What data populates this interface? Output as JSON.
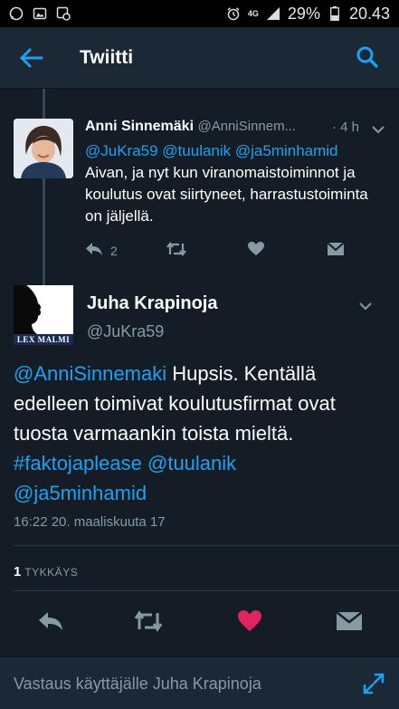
{
  "status_bar": {
    "left_icons": [
      "whatsapp-icon",
      "image-icon",
      "gallery-icon"
    ],
    "right_icons": [
      "alarm-icon",
      "4g-icon",
      "signal-icon",
      "battery-icon"
    ],
    "network": "4G",
    "battery": "29%",
    "time": "20.43"
  },
  "app_bar": {
    "title": "Twiitti",
    "back_icon": "arrow-left-icon",
    "search_icon": "search-icon"
  },
  "reply_tweet": {
    "name": "Anni Sinnemäki",
    "handle": "@AnniSinnem...",
    "time": "· 4 h",
    "mentions": "@JuKra59 @tuulanik @ja5minhamid",
    "text": "Aivan, ja nyt kun viranomaistoiminnot ja koulutus ovat siirtyneet, harrastustoiminta on jäljellä.",
    "reply_count": "2"
  },
  "main_tweet": {
    "name": "Juha Krapinoja",
    "handle": "@JuKra59",
    "avatar_caption": "LEX MALMI",
    "text_mention": "@AnniSinnemaki",
    "text_body": " Hupsis. Kentällä edelleen toimivat koulutusfirmat ovat tuosta varmaankin toista mieltä. ",
    "text_hashtag": "#faktojaplease",
    "text_mention2": " @tuulanik",
    "text_mention3": "@ja5minhamid",
    "timestamp": "16:22 20. maaliskuuta 17",
    "likes_count": "1",
    "likes_label": "TYKKÄYS"
  },
  "reply_bar": {
    "placeholder": "Vastaus käyttäjälle Juha Krapinoja"
  },
  "colors": {
    "background": "#141d26",
    "bar": "#1b2836",
    "accent": "#1da1f2",
    "like": "#e0245e",
    "muted": "#8899a6"
  }
}
